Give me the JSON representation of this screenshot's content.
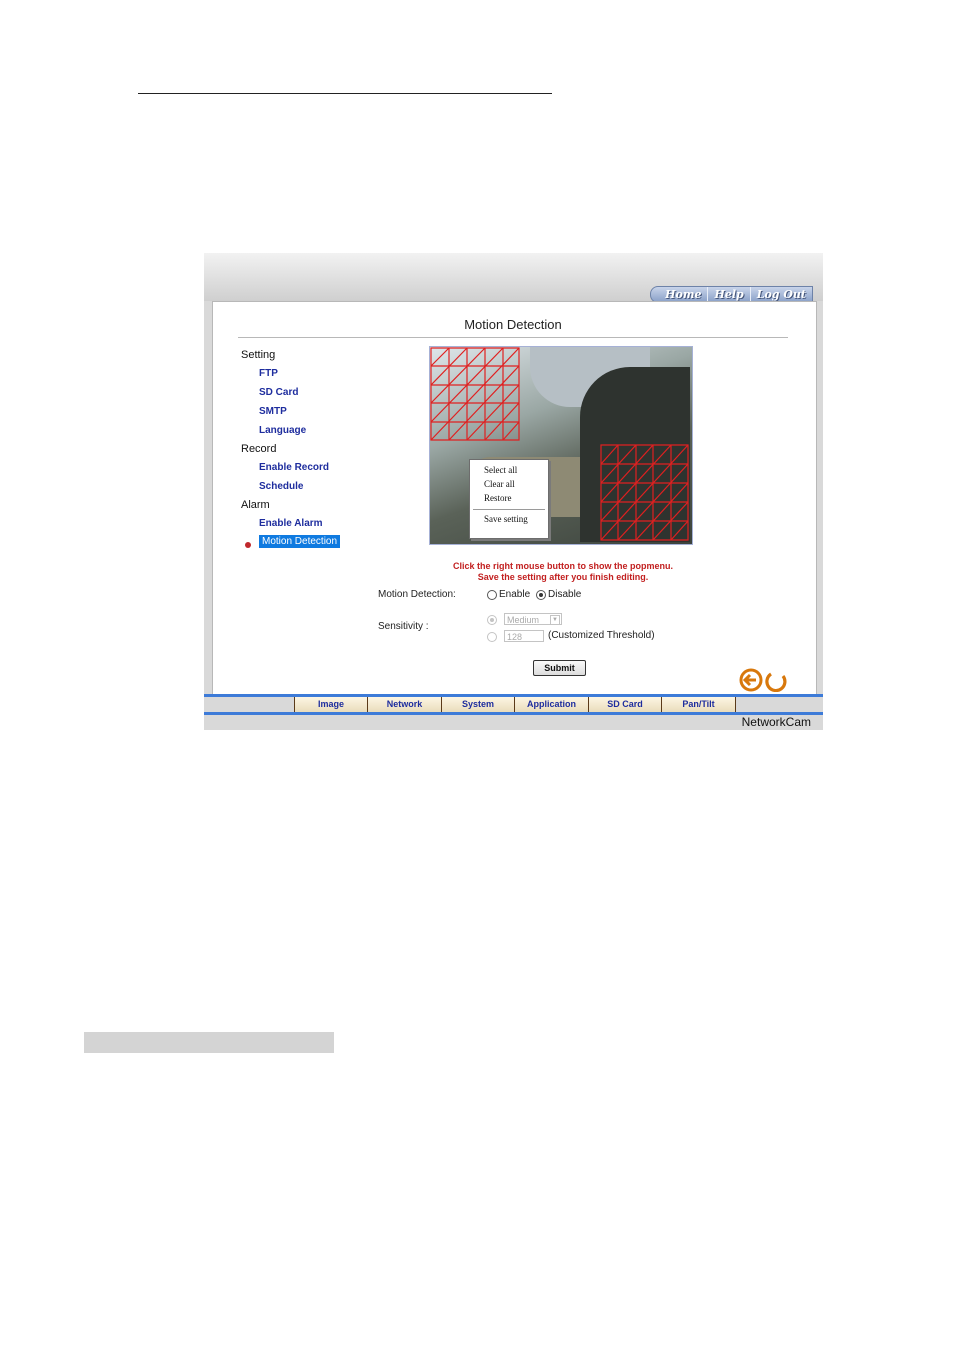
{
  "header_links": [
    "Home",
    "Help",
    "Log Out"
  ],
  "page_title": "Motion Detection",
  "menu": {
    "setting": "Setting",
    "ftp": "FTP",
    "sd_card": "SD Card",
    "smtp": "SMTP",
    "language": "Language",
    "record": "Record",
    "enable_record": "Enable Record",
    "schedule": "Schedule",
    "alarm": "Alarm",
    "enable_alarm": "Enable Alarm",
    "motion_detection": "Motion Detection"
  },
  "popup_menu": [
    "Select all",
    "Clear all",
    "Restore",
    "Save setting"
  ],
  "hint_lines": [
    "Click the right mouse button to show the popmenu.",
    "Save the setting after you finish editing."
  ],
  "motion_detection": {
    "label": "Motion Detection:",
    "enable": "Enable",
    "disable": "Disable",
    "selected": "Disable"
  },
  "sensitivity": {
    "label": "Sensitivity :",
    "preset": "Medium",
    "custom_value": "128",
    "custom_label": "(Customized Threshold)"
  },
  "submit_label": "Submit",
  "tabs": [
    "Image",
    "Network",
    "System",
    "Application",
    "SD Card",
    "Pan/Tilt"
  ],
  "brand": "NetworkCam",
  "colors": {
    "link": "#1e2d9e",
    "selected": "#0f7ae0",
    "hint": "#c22020",
    "grid": "#e02020",
    "tabbar": "#3d7bd8"
  }
}
